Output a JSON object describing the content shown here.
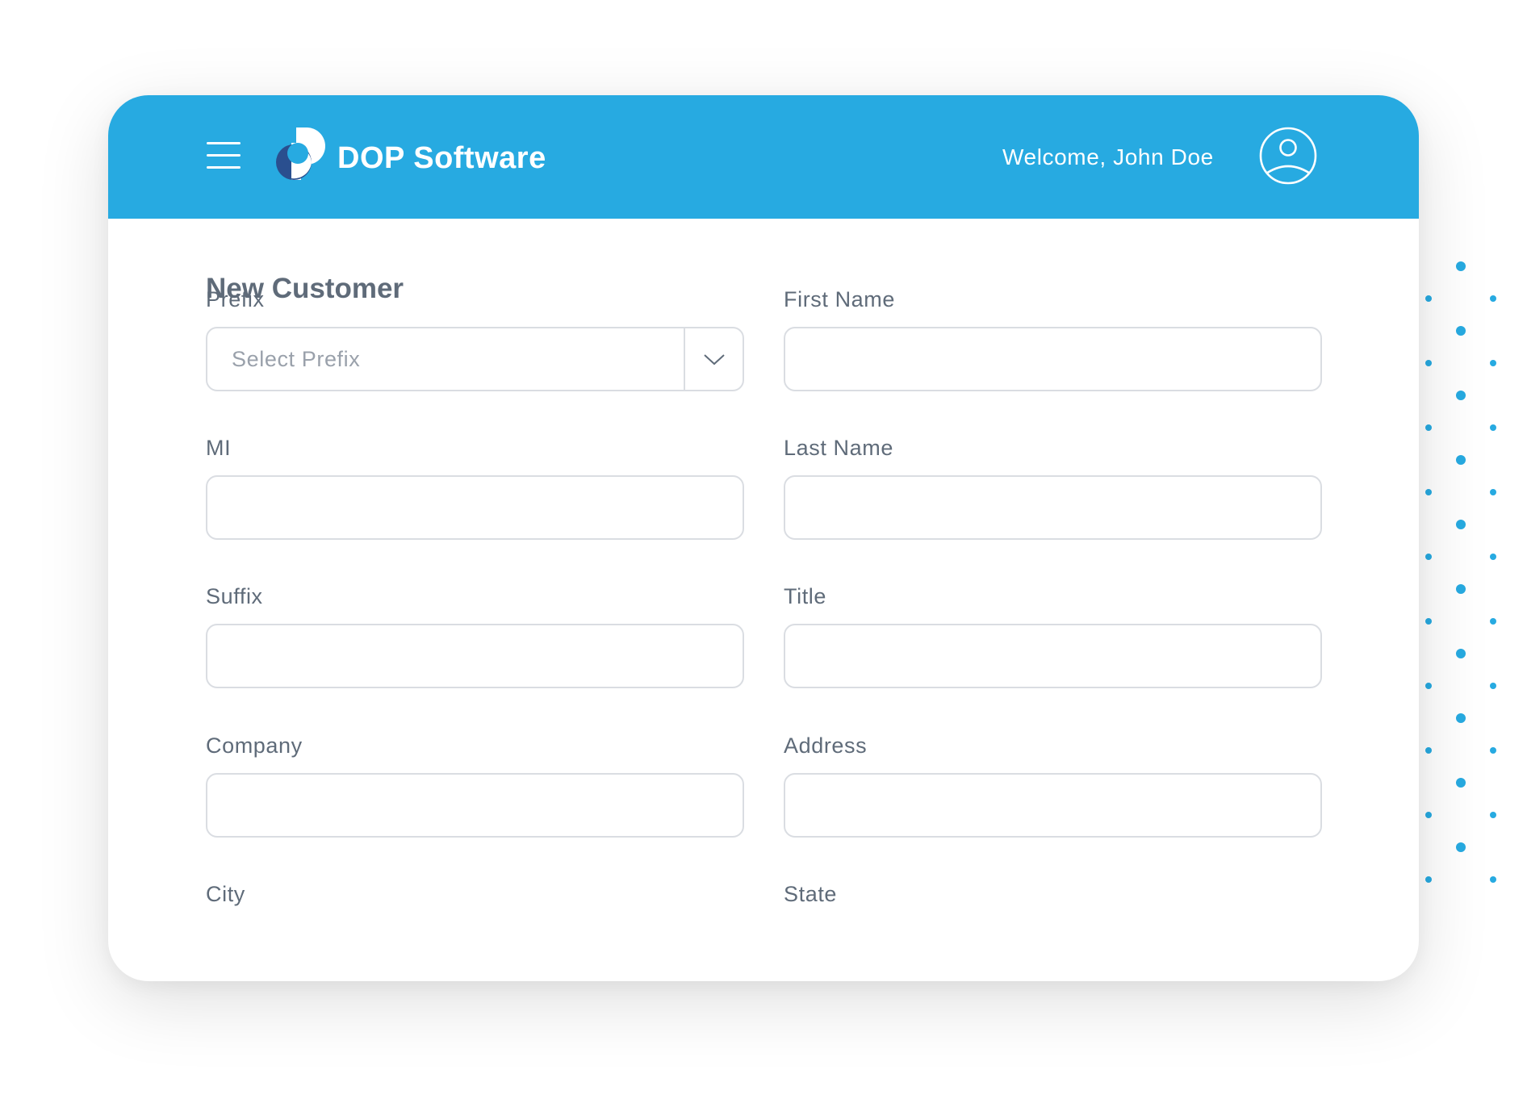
{
  "colors": {
    "header_bg": "#27aae1",
    "text": "#5f6b79",
    "input_border": "#dadde2",
    "placeholder": "#9aa1ab",
    "dot_accent": "#27aae1"
  },
  "header": {
    "menu_icon": "hamburger-menu-icon",
    "logo_icon": "dop-logo-icon",
    "brand": "DOP Software",
    "welcome": "Welcome, John Doe",
    "avatar_icon": "user-profile-icon"
  },
  "form": {
    "title": "New Customer",
    "fields": {
      "prefix": {
        "label": "Prefix",
        "placeholder": "Select Prefix",
        "icon": "chevron-down-icon"
      },
      "first_name": {
        "label": "First Name",
        "value": ""
      },
      "mi": {
        "label": "MI",
        "value": ""
      },
      "last_name": {
        "label": "Last Name",
        "value": ""
      },
      "suffix": {
        "label": "Suffix",
        "value": ""
      },
      "title": {
        "label": "Title",
        "value": ""
      },
      "company": {
        "label": "Company",
        "value": ""
      },
      "address": {
        "label": "Address",
        "value": ""
      },
      "city": {
        "label": "City"
      },
      "state": {
        "label": "State"
      }
    }
  }
}
